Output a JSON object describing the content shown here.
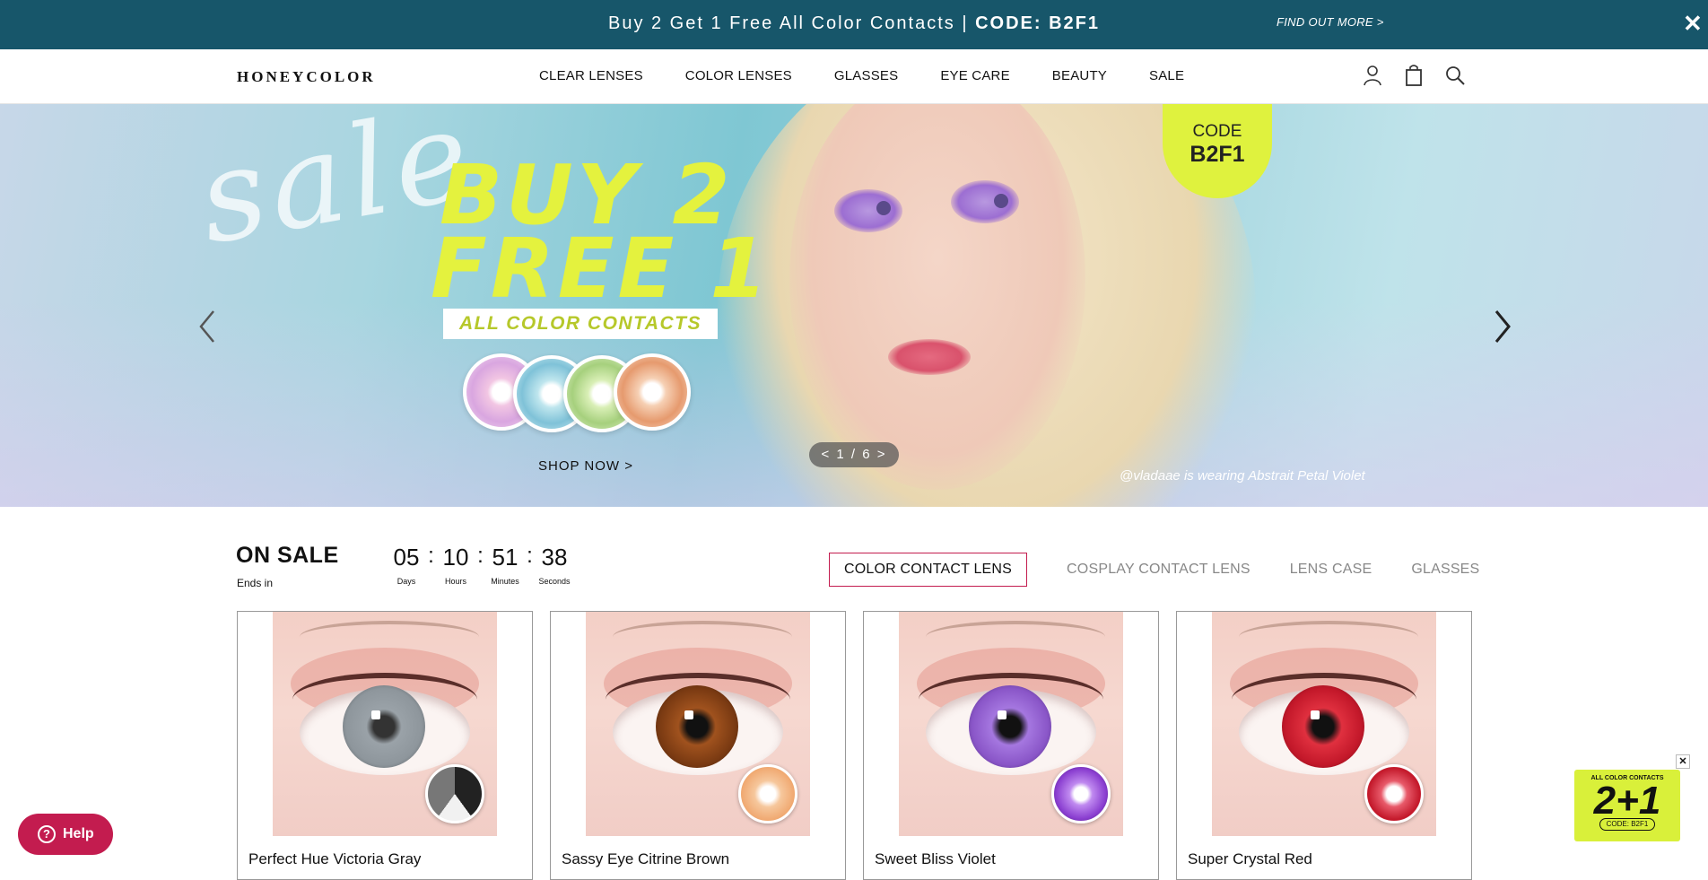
{
  "promo": {
    "message": "Buy 2 Get 1 Free All Color Contacts | ",
    "code": "CODE: B2F1",
    "find_out_more": "FIND OUT MORE >",
    "close": "✕"
  },
  "header": {
    "logo": "HONEYCOLOR",
    "nav": [
      "CLEAR LENSES",
      "COLOR LENSES",
      "GLASSES",
      "EYE CARE",
      "BEAUTY",
      "SALE"
    ],
    "icons": [
      "account-icon",
      "bag-icon",
      "search-icon"
    ]
  },
  "hero": {
    "script_text": "sale",
    "headline_1": "BUY 2",
    "headline_2": "FREE 1",
    "subheadline": "ALL COLOR CONTACTS",
    "shop_now": "SHOP NOW >",
    "slide_counter": "< 1 / 6 >",
    "credit": "@vladaae is wearing Abstrait Petal Violet",
    "code_label": "CODE",
    "code_value": "B2F1",
    "colors": {
      "accent": "#e4f23e"
    }
  },
  "on_sale": {
    "title": "ON SALE",
    "ends_in": "Ends in",
    "timer": [
      {
        "value": "05",
        "label": "Days"
      },
      {
        "value": "10",
        "label": "Hours"
      },
      {
        "value": "51",
        "label": "Minutes"
      },
      {
        "value": "38",
        "label": "Seconds"
      }
    ],
    "tabs": [
      "COLOR CONTACT LENS",
      "COSPLAY CONTACT LENS",
      "LENS CASE",
      "GLASSES"
    ],
    "active_tab": "COLOR CONTACT LENS"
  },
  "products": [
    {
      "name": "Perfect Hue Victoria Gray",
      "iris_color": "#8e969c"
    },
    {
      "name": "Sassy Eye Citrine Brown",
      "iris_color": "#7a3a12"
    },
    {
      "name": "Sweet Bliss Violet",
      "iris_color": "#8a56c8"
    },
    {
      "name": "Super Crystal Red",
      "iris_color": "#c3182a"
    }
  ],
  "help": {
    "label": "Help"
  },
  "float_promo": {
    "top_text": "ALL COLOR CONTACTS",
    "big_text": "2+1",
    "code_text": "CODE: B2F1",
    "close": "✕"
  }
}
